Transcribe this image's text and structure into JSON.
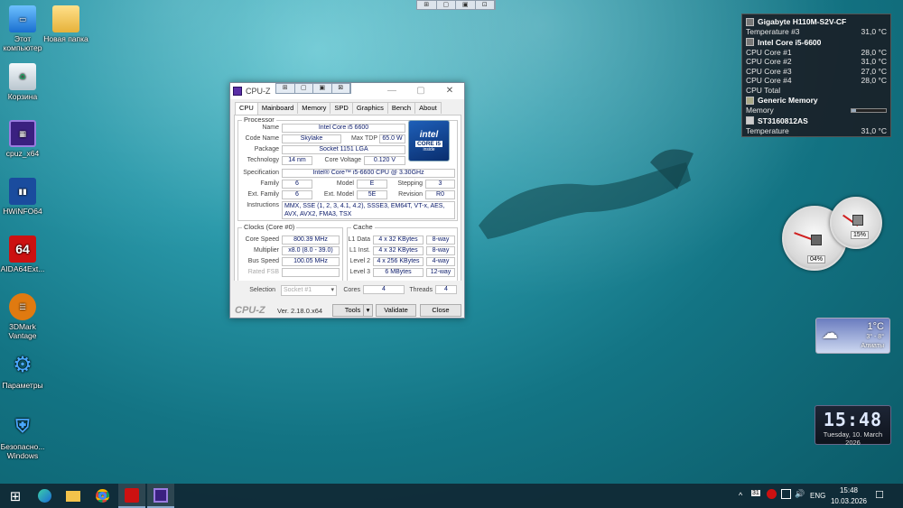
{
  "desktop_icons": [
    {
      "label": "Этот компьютер",
      "icon": "computer-icon"
    },
    {
      "label": "Новая папка",
      "icon": "folder-icon"
    },
    {
      "label": "Корзина",
      "icon": "recycle-bin-icon"
    },
    {
      "label": "cpuz_x64",
      "icon": "cpuz-icon"
    },
    {
      "label": "HWiNFO64",
      "icon": "hwinfo-icon"
    },
    {
      "label": "AIDA64Ext...",
      "icon": "aida64-icon"
    },
    {
      "label": "3DMark Vantage",
      "icon": "3dmark-icon"
    },
    {
      "label": "Параметры",
      "icon": "settings-gear-icon"
    },
    {
      "label": "Безопасно... Windows",
      "icon": "windows-security-icon"
    }
  ],
  "icon_glyphs": {
    "aida": "64"
  },
  "top_strip": [
    "⊞",
    "▢",
    "▣",
    "⊡"
  ],
  "cpuz": {
    "title": "CPU-Z",
    "caption_mini": [
      "⊞",
      "▢",
      "▣",
      "⊠"
    ],
    "window_buttons": [
      "—",
      "▢",
      "✕"
    ],
    "tabs": [
      "CPU",
      "Mainboard",
      "Memory",
      "SPD",
      "Graphics",
      "Bench",
      "About"
    ],
    "processor_group": "Processor",
    "labels": {
      "name": "Name",
      "code_name": "Code Name",
      "max_tdp": "Max TDP",
      "package": "Package",
      "technology": "Technology",
      "core_voltage": "Core Voltage",
      "specification": "Specification",
      "family": "Family",
      "model": "Model",
      "stepping": "Stepping",
      "ext_family": "Ext. Family",
      "ext_model": "Ext. Model",
      "revision": "Revision",
      "instructions": "Instructions",
      "core_speed": "Core Speed",
      "multiplier": "Multiplier",
      "bus_speed": "Bus Speed",
      "rated_fsb": "Rated FSB",
      "l1_data": "L1 Data",
      "l1_inst": "L1 Inst.",
      "level2": "Level 2",
      "level3": "Level 3",
      "selection": "Selection",
      "cores": "Cores",
      "threads": "Threads"
    },
    "values": {
      "name": "Intel Core i5 6600",
      "code_name": "Skylake",
      "max_tdp": "65.0 W",
      "package": "Socket 1151 LGA",
      "technology": "14 nm",
      "core_voltage": "0.120 V",
      "specification": "Intel® Core™ i5-6600 CPU @ 3.30GHz",
      "family": "6",
      "model": "E",
      "stepping": "3",
      "ext_family": "6",
      "ext_model": "5E",
      "revision": "R0",
      "instructions": "MMX, SSE (1, 2, 3, 4.1, 4.2), SSSE3, EM64T, VT-x, AES, AVX, AVX2, FMA3, TSX",
      "core_speed": "800.39 MHz",
      "multiplier": "x8.0 (8.0 - 39.0)",
      "bus_speed": "100.05 MHz",
      "rated_fsb": "",
      "l1_data": "4 x 32 KBytes",
      "l1_data_way": "8-way",
      "l1_inst": "4 x 32 KBytes",
      "l1_inst_way": "8-way",
      "level2": "4 x 256 KBytes",
      "level2_way": "4-way",
      "level3": "6 MBytes",
      "level3_way": "12-way",
      "selection": "Socket #1",
      "cores": "4",
      "threads": "4"
    },
    "clocks_group": "Clocks (Core #0)",
    "cache_group": "Cache",
    "intel_badge": {
      "brand": "intel",
      "line": "CORE i5",
      "sub": "inside"
    },
    "footer": {
      "logo": "CPU-Z",
      "version": "Ver. 2.18.0.x64",
      "tools": "Tools",
      "validate": "Validate",
      "close": "Close"
    }
  },
  "sensors": {
    "board": "Gigabyte H110M-S2V-CF",
    "board_temp_label": "Temperature #3",
    "board_temp": "31,0 °C",
    "cpu": "Intel Core i5-6600",
    "cores": [
      {
        "label": "CPU Core #1",
        "value": "28,0 °C"
      },
      {
        "label": "CPU Core #2",
        "value": "31,0 °C"
      },
      {
        "label": "CPU Core #3",
        "value": "27,0 °C"
      },
      {
        "label": "CPU Core #4",
        "value": "28,0 °C"
      }
    ],
    "cpu_total_label": "CPU Total",
    "memory_group": "Generic Memory",
    "memory_label": "Memory",
    "memory_level": 0.12,
    "disk": "ST3160812AS",
    "disk_temp_label": "Temperature",
    "disk_temp": "31,0 °C"
  },
  "gauges": {
    "cpu_pct": "04%",
    "mem_pct": "15%"
  },
  "weather": {
    "temp": "1°C",
    "range": "3° - 8°",
    "city": "Алматы"
  },
  "clock": {
    "time": "15:48",
    "date": "Tuesday, 10. March 2026"
  },
  "taskbar": {
    "lang": "ENG",
    "time": "15:48",
    "date": "10.03.2026",
    "tray_badge": "31",
    "chevron": "^",
    "speaker": "🔊",
    "notify": "☐",
    "start": "⊞",
    "search": "⌕"
  }
}
